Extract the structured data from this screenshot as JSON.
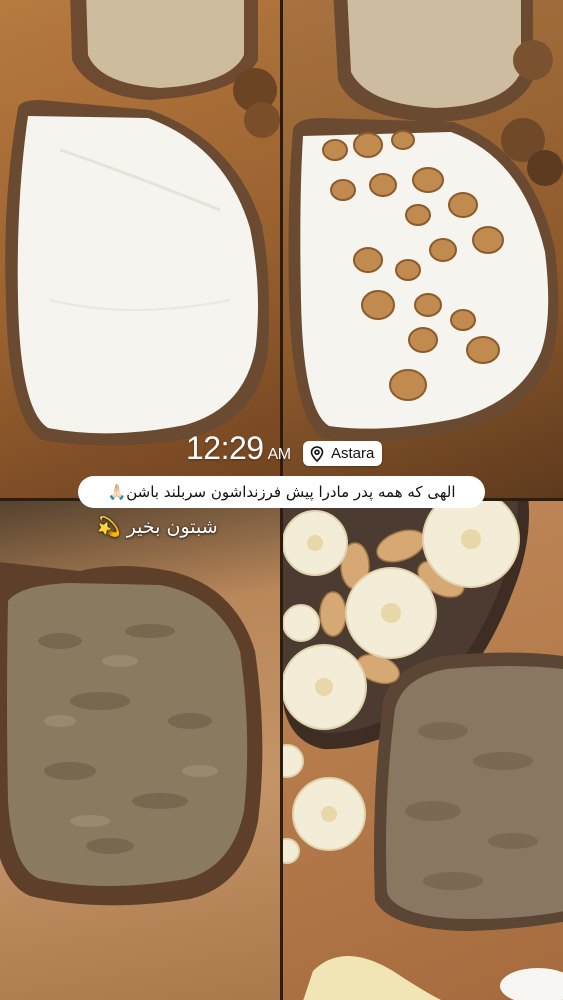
{
  "story": {
    "time": "12:29",
    "ampm": "AM",
    "location": "Astara",
    "caption": "الهی که همه پدر مادرا پیش فرزنداشون سربلند باشن🙏🏻",
    "greeting": "شبتون بخیر 💫"
  },
  "icons": {
    "location": "location-pin-icon"
  },
  "colors": {
    "board": "#b77a3f",
    "crust": "#6a4a31",
    "cream": "#f5f3ee",
    "walnut": "#c18a4e",
    "spread": "#8a7a60",
    "banana": "#f3ecd6"
  }
}
